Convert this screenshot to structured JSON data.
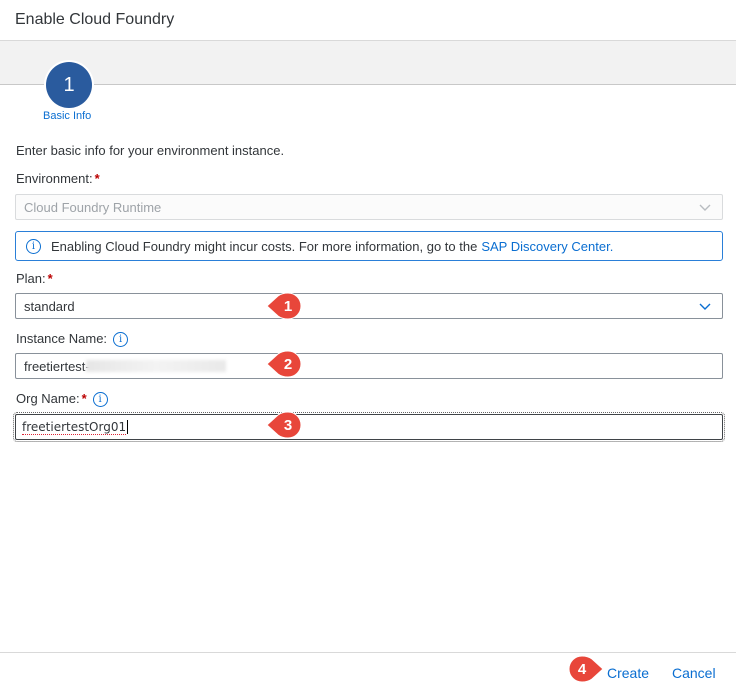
{
  "dialog": {
    "title": "Enable Cloud Foundry"
  },
  "wizard": {
    "step_number": "1",
    "step_label": "Basic Info"
  },
  "form": {
    "intro": "Enter basic info for your environment instance.",
    "environment": {
      "label": "Environment:",
      "required_mark": "*",
      "value": "Cloud Foundry Runtime"
    },
    "info_message": {
      "text": "Enabling Cloud Foundry might incur costs. For more information, go to the",
      "link": "SAP Discovery Center."
    },
    "plan": {
      "label": "Plan:",
      "required_mark": "*",
      "value": "standard"
    },
    "instance_name": {
      "label": "Instance Name:",
      "value": "freetiertest-"
    },
    "org_name": {
      "label": "Org Name:",
      "required_mark": "*",
      "value": "freetiertestOrg01"
    }
  },
  "annotations": [
    {
      "number": "1",
      "color": "#e8463a"
    },
    {
      "number": "2",
      "color": "#e8463a"
    },
    {
      "number": "3",
      "color": "#e8463a"
    },
    {
      "number": "4",
      "color": "#e8463a"
    }
  ],
  "footer": {
    "create_label": "Create",
    "cancel_label": "Cancel"
  },
  "colors": {
    "accent": "#0a6ed1",
    "step": "#2a5b9e",
    "required": "#bb0000",
    "callout": "#e8463a"
  }
}
